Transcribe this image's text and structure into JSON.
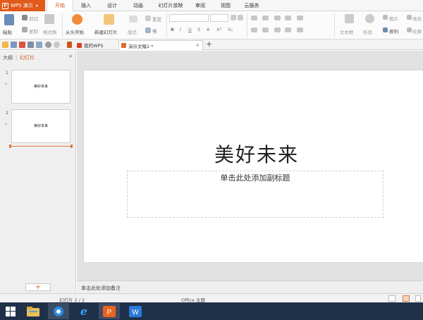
{
  "app": {
    "name": "WPS 演示",
    "logo_glyph": "P"
  },
  "menu": {
    "tabs": [
      {
        "label": "开始",
        "active": true
      },
      {
        "label": "插入"
      },
      {
        "label": "设计"
      },
      {
        "label": "动画"
      },
      {
        "label": "幻灯片放映"
      },
      {
        "label": "审阅"
      },
      {
        "label": "视图"
      },
      {
        "label": "云服务"
      }
    ]
  },
  "ribbon": {
    "paste": "粘贴",
    "cut": "剪切",
    "copy": "复制",
    "format_painter": "格式刷",
    "from_start": "从头开始",
    "new_slide": "新建幻灯片",
    "layout": "版式",
    "reset": "重置",
    "section": "节",
    "text_box": "文本框",
    "shape": "形状",
    "picture": "图片",
    "fill": "填充",
    "arrange": "排列",
    "outline": "轮廓",
    "font_buttons": [
      "B",
      "I",
      "U",
      "S",
      "A",
      "X²",
      "X₂"
    ]
  },
  "quickbar": {
    "tabs": [
      {
        "label": "我的WPS"
      },
      {
        "label": "演示文稿1 *",
        "active": true,
        "close": "×"
      }
    ],
    "new_tab": "+"
  },
  "left_pane": {
    "tabs": [
      "大纲",
      "幻灯片"
    ],
    "close": "×",
    "slides": [
      {
        "num": "1",
        "title": "美好未来",
        "anim": "☼"
      },
      {
        "num": "2",
        "title": "美好未来",
        "anim": "☼"
      }
    ],
    "add_button": "+"
  },
  "slide": {
    "title": "美好未来",
    "subtitle_placeholder": "单击此处添加副标题"
  },
  "notes": {
    "placeholder": "单击此处添加备注"
  },
  "statusbar": {
    "slide_count": "幻灯片 2 / 2",
    "theme": "Office 主题"
  },
  "colors": {
    "accent": "#e05a1c",
    "taskbar": "#1f3049"
  },
  "taskbar": {
    "items": [
      "windows-start-icon",
      "file-explorer-icon",
      "app-icon",
      "internet-explorer-icon",
      "wps-presentation-icon",
      "wps-writer-icon"
    ]
  }
}
